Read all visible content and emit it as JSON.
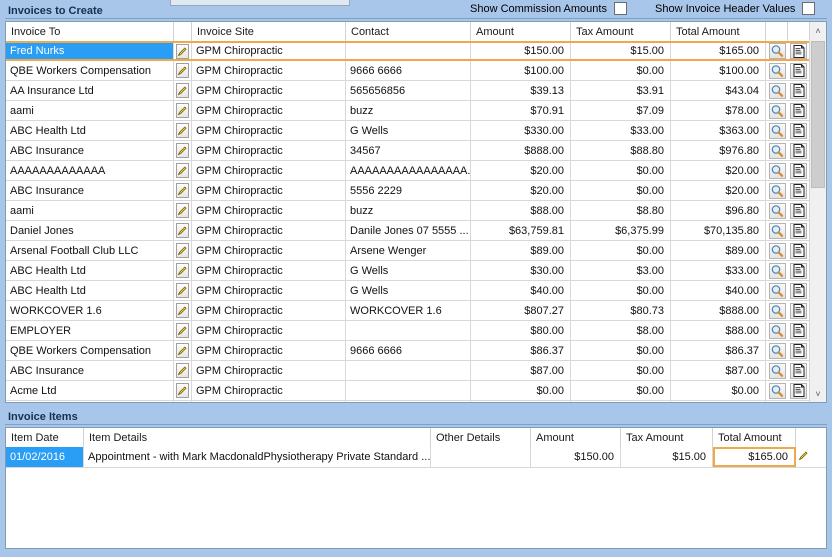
{
  "toolbar": {
    "show_commission_label": "Show Commission Amounts",
    "show_header_values_label": "Show Invoice Header Values",
    "show_commission_checked": false,
    "show_header_values_checked": false
  },
  "invoices_to_create": {
    "title": "Invoices to Create",
    "columns": [
      "Invoice To",
      "",
      "Invoice Site",
      "Contact",
      "Amount",
      "Tax Amount",
      "Total Amount",
      "",
      ""
    ],
    "icons": {
      "edit": "pencil-icon",
      "view": "magnifier-icon",
      "report": "document-icon"
    },
    "rows": [
      {
        "invoice_to": "Fred Nurks",
        "site": "GPM Chiropractic",
        "contact": "",
        "amount": "$150.00",
        "tax": "$15.00",
        "total": "$165.00",
        "selected": true
      },
      {
        "invoice_to": "QBE Workers Compensation",
        "site": "GPM Chiropractic",
        "contact": "9666 6666",
        "amount": "$100.00",
        "tax": "$0.00",
        "total": "$100.00",
        "selected": false
      },
      {
        "invoice_to": "AA Insurance Ltd",
        "site": "GPM Chiropractic",
        "contact": "565656856",
        "amount": "$39.13",
        "tax": "$3.91",
        "total": "$43.04",
        "selected": false
      },
      {
        "invoice_to": "aami",
        "site": "GPM Chiropractic",
        "contact": "buzz",
        "amount": "$70.91",
        "tax": "$7.09",
        "total": "$78.00",
        "selected": false
      },
      {
        "invoice_to": "ABC Health Ltd",
        "site": "GPM Chiropractic",
        "contact": "G Wells",
        "amount": "$330.00",
        "tax": "$33.00",
        "total": "$363.00",
        "selected": false
      },
      {
        "invoice_to": "ABC Insurance",
        "site": "GPM Chiropractic",
        "contact": "34567",
        "amount": "$888.00",
        "tax": "$88.80",
        "total": "$976.80",
        "selected": false
      },
      {
        "invoice_to": "AAAAAAAAAAAAA",
        "site": "GPM Chiropractic",
        "contact": "AAAAAAAAAAAAAAAA...",
        "amount": "$20.00",
        "tax": "$0.00",
        "total": "$20.00",
        "selected": false
      },
      {
        "invoice_to": "ABC Insurance",
        "site": "GPM Chiropractic",
        "contact": "5556 2229",
        "amount": "$20.00",
        "tax": "$0.00",
        "total": "$20.00",
        "selected": false
      },
      {
        "invoice_to": "aami",
        "site": "GPM Chiropractic",
        "contact": "buzz",
        "amount": "$88.00",
        "tax": "$8.80",
        "total": "$96.80",
        "selected": false
      },
      {
        "invoice_to": "Daniel Jones",
        "site": "GPM Chiropractic",
        "contact": "Danile Jones 07 5555 ...",
        "amount": "$63,759.81",
        "tax": "$6,375.99",
        "total": "$70,135.80",
        "selected": false
      },
      {
        "invoice_to": "Arsenal Football Club LLC",
        "site": "GPM Chiropractic",
        "contact": "Arsene Wenger",
        "amount": "$89.00",
        "tax": "$0.00",
        "total": "$89.00",
        "selected": false
      },
      {
        "invoice_to": "ABC Health Ltd",
        "site": "GPM Chiropractic",
        "contact": "G Wells",
        "amount": "$30.00",
        "tax": "$3.00",
        "total": "$33.00",
        "selected": false
      },
      {
        "invoice_to": "ABC Health Ltd",
        "site": "GPM Chiropractic",
        "contact": "G Wells",
        "amount": "$40.00",
        "tax": "$0.00",
        "total": "$40.00",
        "selected": false
      },
      {
        "invoice_to": "WORKCOVER 1.6",
        "site": "GPM Chiropractic",
        "contact": "WORKCOVER 1.6",
        "amount": "$807.27",
        "tax": "$80.73",
        "total": "$888.00",
        "selected": false
      },
      {
        "invoice_to": "EMPLOYER",
        "site": "GPM Chiropractic",
        "contact": "",
        "amount": "$80.00",
        "tax": "$8.00",
        "total": "$88.00",
        "selected": false
      },
      {
        "invoice_to": "QBE Workers Compensation",
        "site": "GPM Chiropractic",
        "contact": "9666 6666",
        "amount": "$86.37",
        "tax": "$0.00",
        "total": "$86.37",
        "selected": false
      },
      {
        "invoice_to": "ABC Insurance",
        "site": "GPM Chiropractic",
        "contact": "",
        "amount": "$87.00",
        "tax": "$0.00",
        "total": "$87.00",
        "selected": false
      },
      {
        "invoice_to": "Acme Ltd",
        "site": "GPM Chiropractic",
        "contact": "",
        "amount": "$0.00",
        "tax": "$0.00",
        "total": "$0.00",
        "selected": false
      }
    ],
    "scrollbar": {
      "up_glyph": "˄",
      "down_glyph": "˅"
    }
  },
  "invoice_items": {
    "title": "Invoice Items",
    "columns": [
      "Item Date",
      "Item Details",
      "Other Details",
      "Amount",
      "Tax Amount",
      "Total Amount",
      ""
    ],
    "rows": [
      {
        "item_date": "01/02/2016",
        "item_details": "Appointment -  with Mark MacdonaldPhysiotherapy Private Standard ...",
        "other_details": "",
        "amount": "$150.00",
        "tax": "$15.00",
        "total": "$165.00"
      }
    ]
  },
  "colors": {
    "window_bg": "#a8c6ea",
    "selection_blue": "#2a9df4",
    "focus_orange": "#f0a84b",
    "grid_border": "#7f9db9",
    "title_text": "#16314f"
  }
}
